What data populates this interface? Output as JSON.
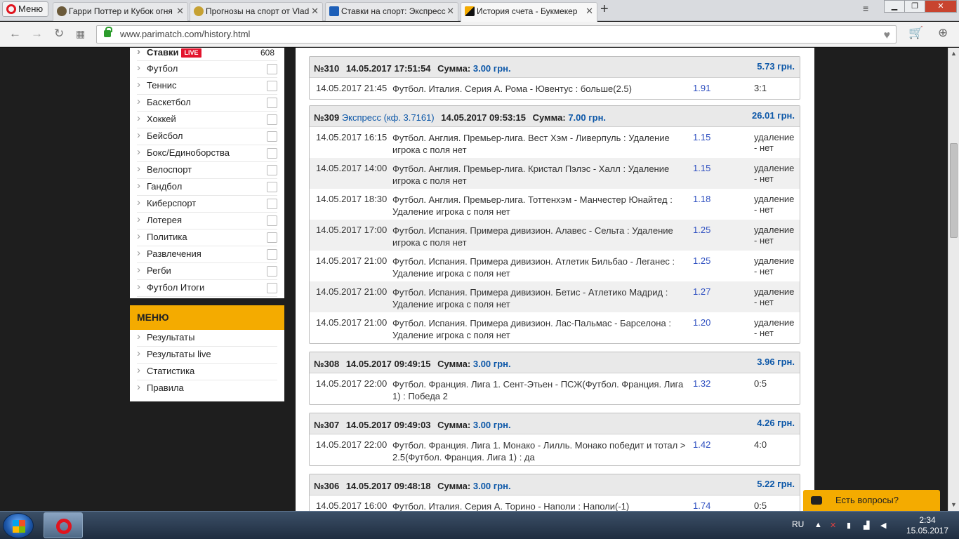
{
  "browser": {
    "menu_label": "Меню",
    "tabs": [
      {
        "title": "Гарри Поттер и Кубок огня",
        "active": false
      },
      {
        "title": "Прогнозы на спорт от Vlad",
        "active": false
      },
      {
        "title": "Ставки на спорт: Экспресс",
        "active": false
      },
      {
        "title": "История счета - Букмекер",
        "active": true
      }
    ],
    "new_tab": "+",
    "url": "www.parimatch.com/history.html"
  },
  "sidebar": {
    "bets_label": "Ставки",
    "live_badge": "LIVE",
    "bets_count": "608",
    "sports": [
      "Футбол",
      "Теннис",
      "Баскетбол",
      "Хоккей",
      "Бейсбол",
      "Бокс/Единоборства",
      "Велоспорт",
      "Гандбол",
      "Киберспорт",
      "Лотерея",
      "Политика",
      "Развлечения",
      "Регби",
      "Футбол Итоги"
    ],
    "menu_title": "МЕНЮ",
    "menu_items": [
      "Результаты",
      "Результаты live",
      "Статистика",
      "Правила"
    ]
  },
  "bets": [
    {
      "number": "№310",
      "express": "",
      "placed": "14.05.2017 17:51:54",
      "sum_label": "Сумма:",
      "sum": "3.00 грн.",
      "win": "5.73 грн.",
      "events": [
        {
          "date": "14.05.2017 21:45",
          "name": "Футбол. Италия. Серия А. Рома - Ювентус : больше(2.5)",
          "coef": "1.91",
          "result": "3:1"
        }
      ]
    },
    {
      "number": "№309",
      "express": "Экспресс (кф. 3.7161)",
      "placed": "14.05.2017 09:53:15",
      "sum_label": "Сумма:",
      "sum": "7.00 грн.",
      "win": "26.01 грн.",
      "events": [
        {
          "date": "14.05.2017 16:15",
          "name": "Футбол. Англия. Премьер-лига. Вест Хэм - Ливерпуль : Удаление игрока с поля нет",
          "coef": "1.15",
          "result": "удаление - нет"
        },
        {
          "date": "14.05.2017 14:00",
          "name": "Футбол. Англия. Премьер-лига. Кристал Пэлэс - Халл : Удаление игрока с поля нет",
          "coef": "1.15",
          "result": "удаление - нет"
        },
        {
          "date": "14.05.2017 18:30",
          "name": "Футбол. Англия. Премьер-лига. Тоттенхэм - Манчестер Юнайтед : Удаление игрока с поля нет",
          "coef": "1.18",
          "result": "удаление - нет"
        },
        {
          "date": "14.05.2017 17:00",
          "name": "Футбол. Испания. Примера дивизион. Алавес - Сельта : Удаление игрока с поля нет",
          "coef": "1.25",
          "result": "удаление - нет"
        },
        {
          "date": "14.05.2017 21:00",
          "name": "Футбол. Испания. Примера дивизион. Атлетик Бильбао - Леганес : Удаление игрока с поля нет",
          "coef": "1.25",
          "result": "удаление - нет"
        },
        {
          "date": "14.05.2017 21:00",
          "name": "Футбол. Испания. Примера дивизион. Бетис - Атлетико Мадрид : Удаление игрока с поля нет",
          "coef": "1.27",
          "result": "удаление - нет"
        },
        {
          "date": "14.05.2017 21:00",
          "name": "Футбол. Испания. Примера дивизион. Лас-Пальмас - Барселона : Удаление игрока с поля нет",
          "coef": "1.20",
          "result": "удаление - нет"
        }
      ]
    },
    {
      "number": "№308",
      "express": "",
      "placed": "14.05.2017 09:49:15",
      "sum_label": "Сумма:",
      "sum": "3.00 грн.",
      "win": "3.96 грн.",
      "events": [
        {
          "date": "14.05.2017 22:00",
          "name": "Футбол. Франция. Лига 1. Сент-Этьен - ПСЖ(Футбол. Франция. Лига 1) : Победа 2",
          "coef": "1.32",
          "result": "0:5"
        }
      ]
    },
    {
      "number": "№307",
      "express": "",
      "placed": "14.05.2017 09:49:03",
      "sum_label": "Сумма:",
      "sum": "3.00 грн.",
      "win": "4.26 грн.",
      "events": [
        {
          "date": "14.05.2017 22:00",
          "name": "Футбол. Франция. Лига 1. Монако - Лилль. Монако победит и тотал > 2.5(Футбол. Франция. Лига 1) : да",
          "coef": "1.42",
          "result": "4:0"
        }
      ]
    },
    {
      "number": "№306",
      "express": "",
      "placed": "14.05.2017 09:48:18",
      "sum_label": "Сумма:",
      "sum": "3.00 грн.",
      "win": "5.22 грн.",
      "events": [
        {
          "date": "14.05.2017 16:00",
          "name": "Футбол. Италия. Серия А. Торино - Наполи : Наполи(-1)",
          "coef": "1.74",
          "result": "0:5"
        }
      ]
    }
  ],
  "chat": {
    "label": "Есть вопросы?"
  },
  "taskbar": {
    "lang": "RU",
    "time": "2:34",
    "date": "15.05.2017"
  },
  "colors": {
    "accent": "#f4ab00",
    "link_blue": "#0c57a8",
    "coef_blue": "#2e4fc0",
    "live_red": "#e3142d"
  }
}
